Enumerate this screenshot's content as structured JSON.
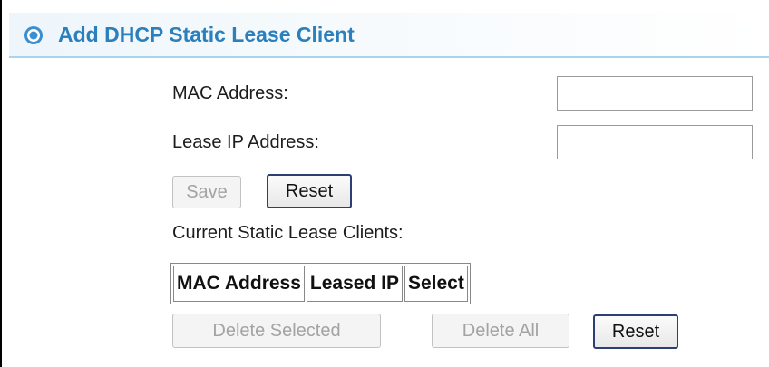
{
  "section": {
    "title": "Add DHCP Static Lease Client",
    "icon": "target-icon"
  },
  "form": {
    "mac_label": "MAC Address:",
    "mac_value": "",
    "ip_label": "Lease IP Address:",
    "ip_value": "",
    "save_label": "Save",
    "reset_label": "Reset"
  },
  "clients": {
    "heading": "Current Static Lease Clients:",
    "columns": [
      "MAC Address",
      "Leased IP",
      "Select"
    ],
    "rows": [],
    "delete_selected_label": "Delete Selected",
    "delete_all_label": "Delete All",
    "reset_label": "Reset"
  },
  "colors": {
    "title": "#2a7fbc",
    "header_border": "#a8d4ee",
    "active_button_border": "#2c3f73"
  }
}
